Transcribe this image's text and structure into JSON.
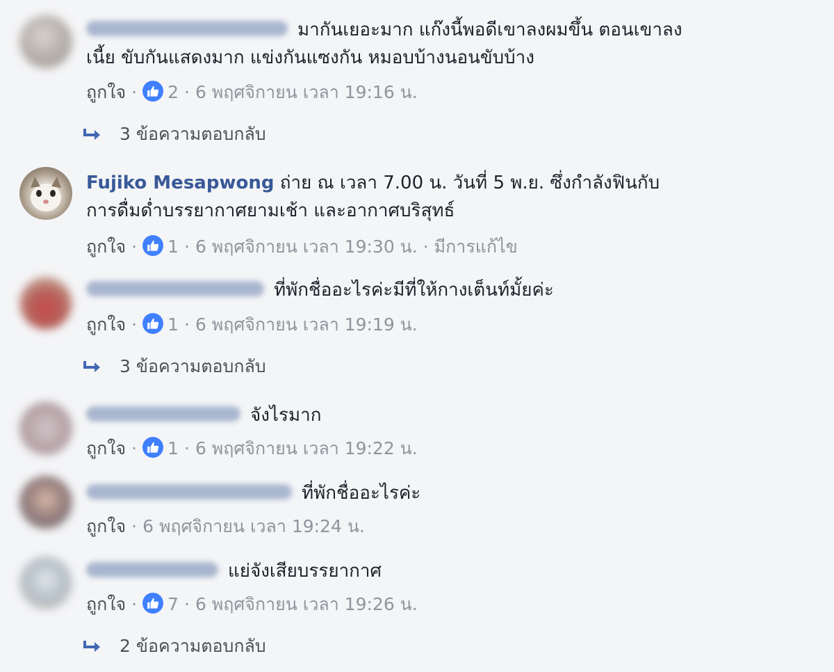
{
  "comments": [
    {
      "author": "",
      "text_lines": [
        "มากันเยอะมาก แก๊งนี้พอดีเขาลงผมขึ้น ตอนเขาลง",
        "เนี้ย ขับกันแสดงมาก แข่งกันแซงกัน หมอบบ้างนอนขับบ้าง"
      ],
      "like_label": "ถูกใจ",
      "likes": "2",
      "timestamp": "6 พฤศจิกายน เวลา 19:16 น.",
      "edited": "",
      "replies": "3 ข้อความตอบกลับ"
    },
    {
      "author": "Fujiko Mesapwong",
      "text_lines": [
        "ถ่าย ณ เวลา 7.00 น. วันที่ 5 พ.ย. ซึ่งกำลังฟินกับ",
        "การดื่มด่ำบรรยากาศยามเช้า และอากาศบริสุทธ์"
      ],
      "like_label": "ถูกใจ",
      "likes": "1",
      "timestamp": "6 พฤศจิกายน เวลา 19:30 น.",
      "edited": "มีการแก้ไข",
      "replies": ""
    },
    {
      "author": "",
      "text_lines": [
        "ที่พักชื่ออะไรค่ะมีที่ให้กางเต็นท์มั้ยค่ะ"
      ],
      "like_label": "ถูกใจ",
      "likes": "1",
      "timestamp": "6 พฤศจิกายน เวลา 19:19 น.",
      "edited": "",
      "replies": "3 ข้อความตอบกลับ"
    },
    {
      "author": "",
      "text_lines": [
        "จังไรมาก"
      ],
      "like_label": "ถูกใจ",
      "likes": "1",
      "timestamp": "6 พฤศจิกายน เวลา 19:22 น.",
      "edited": "",
      "replies": ""
    },
    {
      "author": "",
      "text_lines": [
        "ที่พักชื่ออะไรค่ะ"
      ],
      "like_label": "ถูกใจ",
      "likes": "",
      "timestamp": "6 พฤศจิกายน เวลา 19:24 น.",
      "edited": "",
      "replies": ""
    },
    {
      "author": "",
      "text_lines": [
        "แย่จังเสียบรรยากาศ"
      ],
      "like_label": "ถูกใจ",
      "likes": "7",
      "timestamp": "6 พฤศจิกายน เวลา 19:26 น.",
      "edited": "",
      "replies": "2 ข้อความตอบกลับ"
    }
  ],
  "icons": {
    "like_badge": "thumbs-up-icon",
    "reply_arrow": "reply-arrow-icon"
  },
  "colors": {
    "author": "#385898",
    "like_badge": "#4080ff",
    "meta": "#90949c",
    "text": "#1d2129",
    "background": "#f4f5f7"
  }
}
